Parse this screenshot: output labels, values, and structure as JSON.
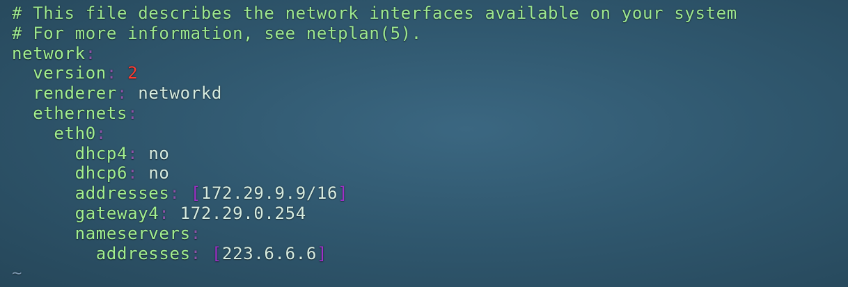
{
  "editor": {
    "comments": [
      "# This file describes the network interfaces available on your system",
      "# For more information, see netplan(5)."
    ],
    "yaml": {
      "network": {
        "key": "network",
        "colon": ":"
      },
      "version": {
        "indent": "  ",
        "key": "version",
        "colon": ":",
        "value": "2"
      },
      "renderer": {
        "indent": "  ",
        "key": "renderer",
        "colon": ":",
        "value": "networkd"
      },
      "ethernets": {
        "indent": "  ",
        "key": "ethernets",
        "colon": ":"
      },
      "eth0": {
        "indent": "    ",
        "key": "eth0",
        "colon": ":"
      },
      "dhcp4": {
        "indent": "      ",
        "key": "dhcp4",
        "colon": ":",
        "value": "no"
      },
      "dhcp6": {
        "indent": "      ",
        "key": "dhcp6",
        "colon": ":",
        "value": "no"
      },
      "addresses": {
        "indent": "      ",
        "key": "addresses",
        "colon": ":",
        "open": "[",
        "value": "172.29.9.9/16",
        "close": "]"
      },
      "gateway4": {
        "indent": "      ",
        "key": "gateway4",
        "colon": ":",
        "value": "172.29.0.254"
      },
      "nameservers": {
        "indent": "      ",
        "key": "nameservers",
        "colon": ":"
      },
      "ns_addresses": {
        "indent": "        ",
        "key": "addresses",
        "colon": ":",
        "open": "[",
        "value": "223.6.6.6",
        "close": "]"
      }
    },
    "empty_line_marker": "~"
  }
}
